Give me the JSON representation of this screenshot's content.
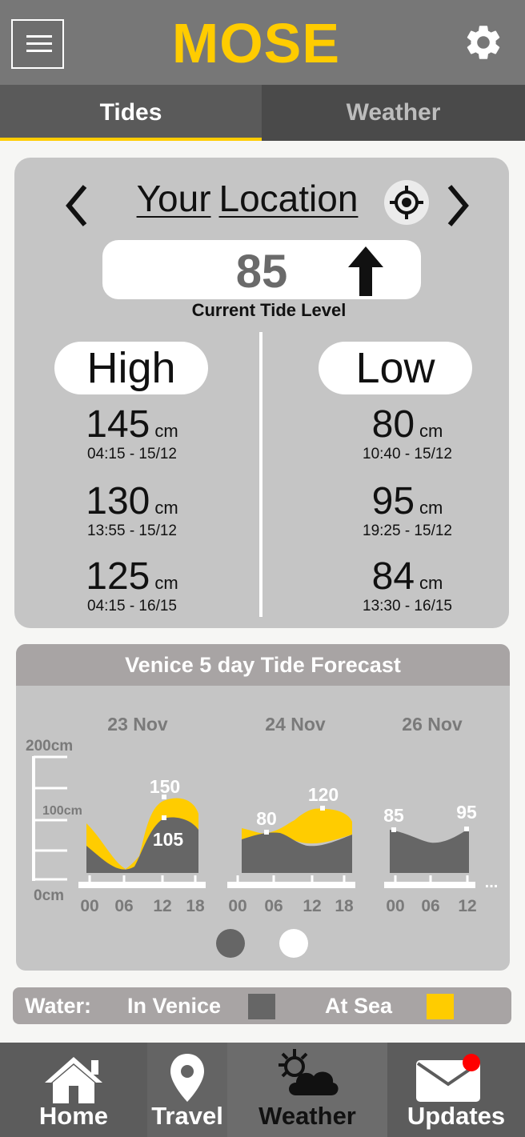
{
  "app": {
    "title": "MOSE"
  },
  "tabs": [
    {
      "label": "Tides",
      "active": true
    },
    {
      "label": "Weather",
      "active": false
    }
  ],
  "location": {
    "title_part1": "Your",
    "title_part2": "Location"
  },
  "current": {
    "value": "85",
    "label": "Current Tide Level",
    "trend": "rising"
  },
  "high": {
    "label": "High",
    "entries": [
      {
        "value": "145",
        "unit": "cm",
        "time": "04:15 - 15/12"
      },
      {
        "value": "130",
        "unit": "cm",
        "time": "13:55 - 15/12"
      },
      {
        "value": "125",
        "unit": "cm",
        "time": "04:15 - 16/15"
      }
    ]
  },
  "low": {
    "label": "Low",
    "entries": [
      {
        "value": "80",
        "unit": "cm",
        "time": "10:40 - 15/12"
      },
      {
        "value": "95",
        "unit": "cm",
        "time": "19:25 - 15/12"
      },
      {
        "value": "84",
        "unit": "cm",
        "time": "13:30 - 16/15"
      }
    ]
  },
  "forecast": {
    "title": "Venice 5 day Tide Forecast",
    "y_ticks": [
      "200cm",
      "100cm",
      "0cm"
    ],
    "days": [
      "23 Nov",
      "24 Nov",
      "26 Nov"
    ],
    "hours": {
      "day1": [
        "00",
        "06",
        "12",
        "18"
      ],
      "day2": [
        "00",
        "06",
        "12",
        "18"
      ],
      "day3": [
        "00",
        "06",
        "12"
      ]
    },
    "annotations": {
      "d1_sea_peak": "150",
      "d1_venice_peak": "105",
      "d2_low": "80",
      "d2_high": "120",
      "d3_start": "85",
      "d3_end": "95"
    },
    "more": "...",
    "page": {
      "current": 1,
      "total": 2
    }
  },
  "legend": {
    "prefix": "Water:",
    "in_venice": "In Venice",
    "at_sea": "At Sea",
    "in_venice_color": "#666666",
    "at_sea_color": "#ffcc00"
  },
  "nav": [
    {
      "label": "Home",
      "icon": "home-icon"
    },
    {
      "label": "Travel",
      "icon": "location-pin-icon"
    },
    {
      "label": "Weather",
      "icon": "sun-cloud-icon",
      "active": true
    },
    {
      "label": "Updates",
      "icon": "mail-icon",
      "has_notification": true
    }
  ],
  "colors": {
    "accent": "#ffcc00",
    "venice": "#666666",
    "notification": "#ff0000"
  }
}
